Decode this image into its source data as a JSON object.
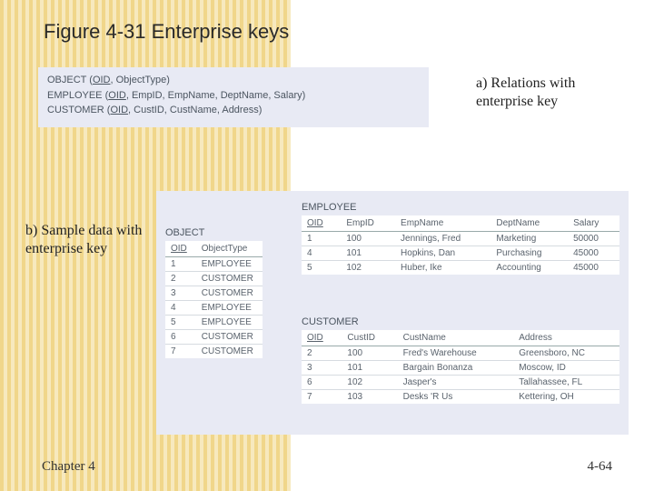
{
  "title": "Figure 4-31 Enterprise keys",
  "caption_a": "a) Relations with enterprise key",
  "caption_b": "b) Sample data with enterprise key",
  "footer_left": "Chapter 4",
  "footer_right": "4-64",
  "relations": {
    "object": {
      "name": "OBJECT",
      "key": "OID",
      "rest": ", ObjectType)"
    },
    "employee": {
      "name": "EMPLOYEE",
      "key": "OID",
      "rest": ", EmpID, EmpName, DeptName, Salary)"
    },
    "customer": {
      "name": "CUSTOMER",
      "key": "OID",
      "rest": ", CustID, CustName, Address)"
    }
  },
  "tables": {
    "object": {
      "name": "OBJECT",
      "headers": [
        "OID",
        "ObjectType"
      ],
      "rows": [
        [
          "1",
          "EMPLOYEE"
        ],
        [
          "2",
          "CUSTOMER"
        ],
        [
          "3",
          "CUSTOMER"
        ],
        [
          "4",
          "EMPLOYEE"
        ],
        [
          "5",
          "EMPLOYEE"
        ],
        [
          "6",
          "CUSTOMER"
        ],
        [
          "7",
          "CUSTOMER"
        ]
      ]
    },
    "employee": {
      "name": "EMPLOYEE",
      "headers": [
        "OID",
        "EmpID",
        "EmpName",
        "DeptName",
        "Salary"
      ],
      "rows": [
        [
          "1",
          "100",
          "Jennings, Fred",
          "Marketing",
          "50000"
        ],
        [
          "4",
          "101",
          "Hopkins, Dan",
          "Purchasing",
          "45000"
        ],
        [
          "5",
          "102",
          "Huber, Ike",
          "Accounting",
          "45000"
        ]
      ]
    },
    "customer": {
      "name": "CUSTOMER",
      "headers": [
        "OID",
        "CustID",
        "CustName",
        "Address"
      ],
      "rows": [
        [
          "2",
          "100",
          "Fred's Warehouse",
          "Greensboro, NC"
        ],
        [
          "3",
          "101",
          "Bargain Bonanza",
          "Moscow, ID"
        ],
        [
          "6",
          "102",
          "Jasper's",
          "Tallahassee, FL"
        ],
        [
          "7",
          "103",
          "Desks 'R Us",
          "Kettering, OH"
        ]
      ]
    }
  }
}
